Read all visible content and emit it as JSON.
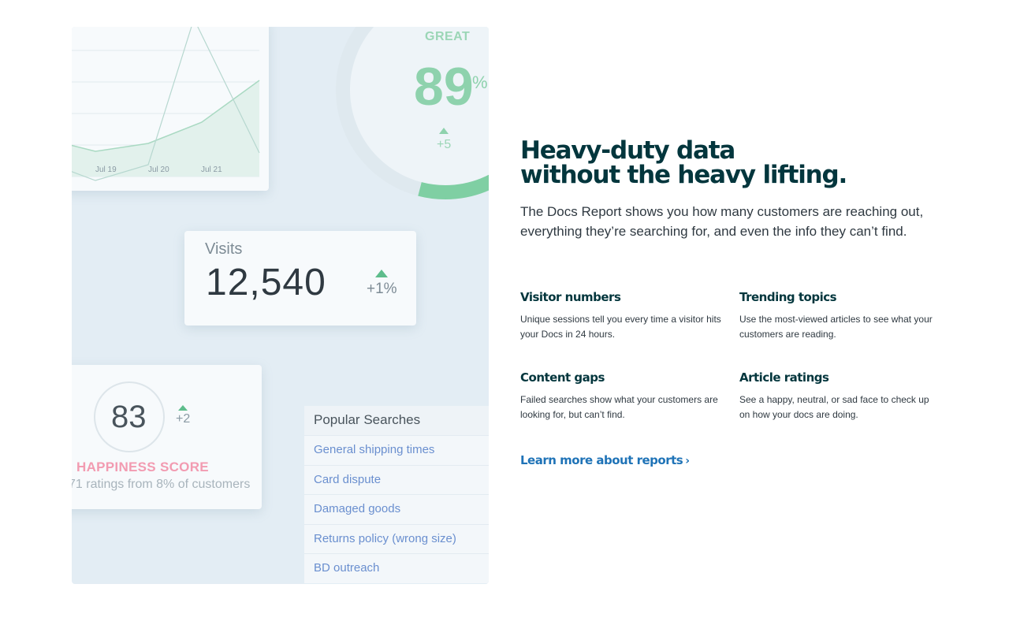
{
  "illustration": {
    "chart": {
      "tick_labels": [
        "Jul 19",
        "Jul 20",
        "Jul 21"
      ]
    },
    "gauge": {
      "label": "GREAT",
      "value": "89",
      "unit": "%",
      "delta": "+5",
      "fill": 0.89
    },
    "visits": {
      "label": "Visits",
      "value": "12,540",
      "delta": "+1%"
    },
    "happiness": {
      "value": "83",
      "delta": "+2",
      "title": "HAPPINESS SCORE",
      "subtitle": "71 ratings from 8% of customers"
    },
    "popular_searches": {
      "title": "Popular Searches",
      "items": [
        "General shipping times",
        "Card dispute",
        "Damaged goods",
        "Returns policy (wrong size)",
        "BD outreach"
      ]
    }
  },
  "content": {
    "headline_line1": "Heavy-duty data",
    "headline_line2": "without the heavy lifting.",
    "intro": "The Docs Report shows you how many customers are reaching out, everything they’re searching for, and even the info they can’t find.",
    "features": [
      {
        "title": "Visitor numbers",
        "body": "Unique sessions tell you every time a visitor hits your Docs in 24 hours."
      },
      {
        "title": "Trending topics",
        "body": "Use the most-viewed articles to see what your customers are reading."
      },
      {
        "title": "Content gaps",
        "body": "Failed searches show what your customers are looking for, but can’t find."
      },
      {
        "title": "Article ratings",
        "body": "See a happy, neutral, or sad face to check up on how your docs are doing."
      }
    ],
    "learn_more": "Learn more about reports",
    "learn_more_icon": "chevron-right-icon"
  },
  "colors": {
    "accent_green": "#5ebd8c",
    "link_blue": "#1f73b7",
    "heading": "#03363d",
    "happiness_pink": "#f29bb1"
  }
}
